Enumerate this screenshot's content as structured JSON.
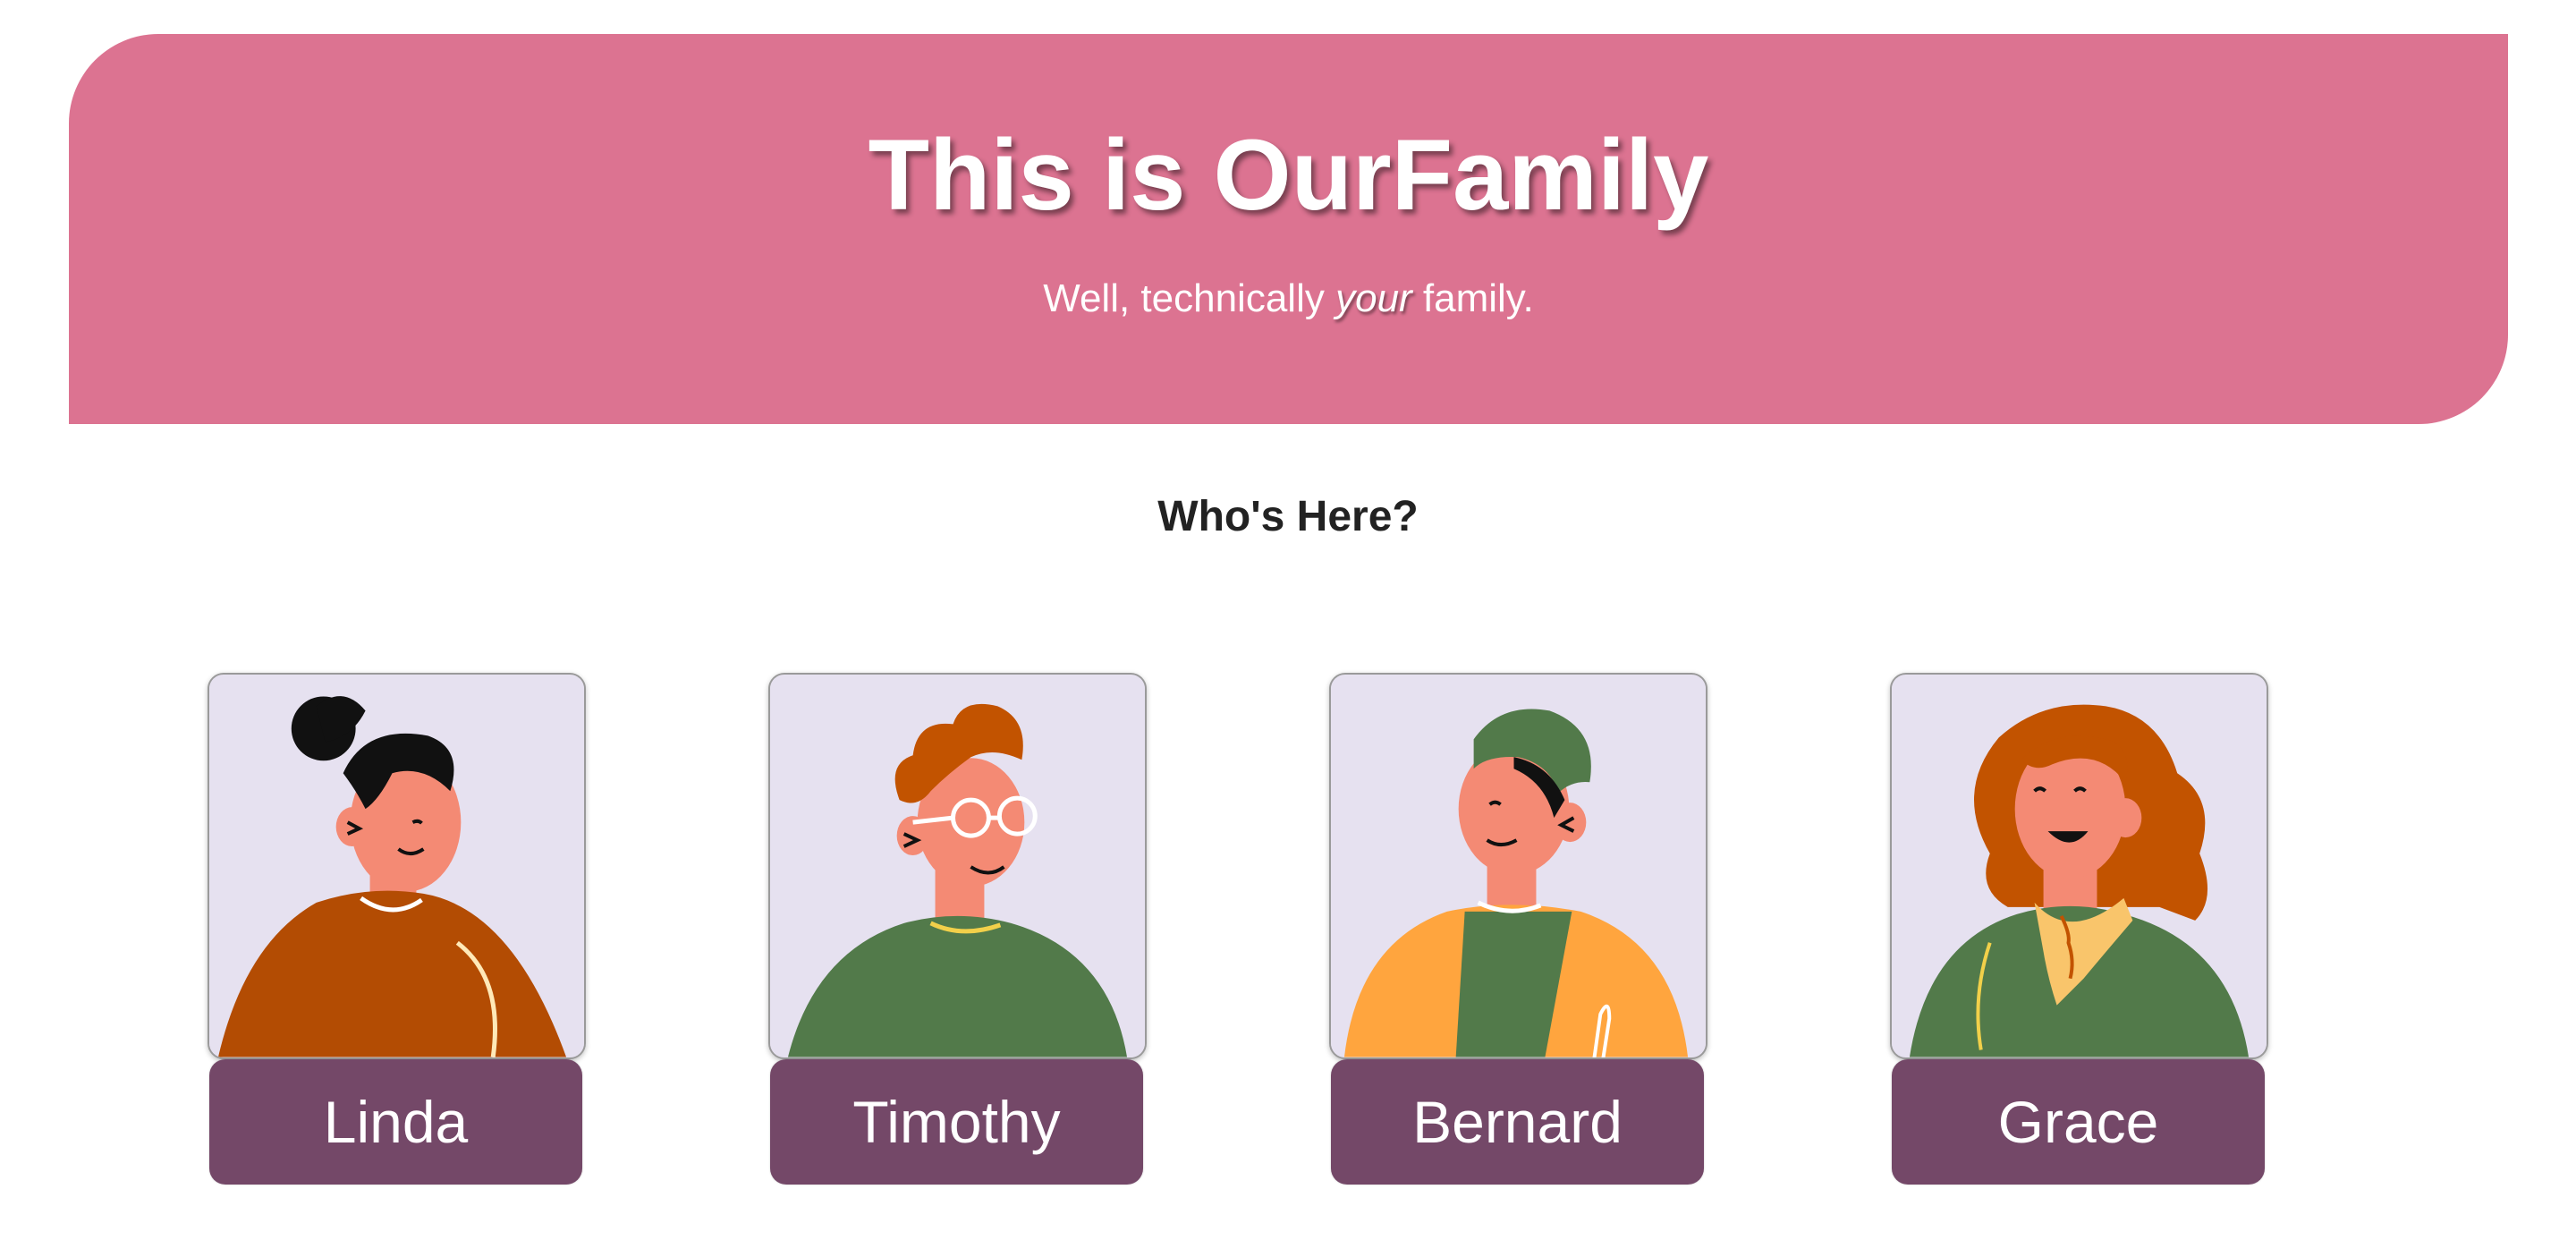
{
  "hero": {
    "title": "This is OurFamily",
    "subtitle_before": "Well, technically ",
    "subtitle_emphasis": "your",
    "subtitle_after": " family."
  },
  "section": {
    "title": "Who's Here?"
  },
  "members": [
    {
      "name": "Linda",
      "avatar": "woman-bun-hair-avatar"
    },
    {
      "name": "Timothy",
      "avatar": "man-glasses-avatar"
    },
    {
      "name": "Bernard",
      "avatar": "man-beanie-avatar"
    },
    {
      "name": "Grace",
      "avatar": "woman-long-hair-avatar"
    }
  ],
  "colors": {
    "hero_background": "#dc7391",
    "name_tag": "#744868",
    "portrait_background": "#e6e1f0"
  }
}
